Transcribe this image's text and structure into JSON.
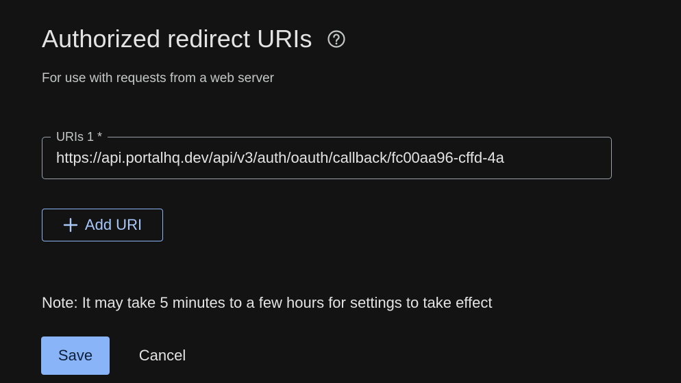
{
  "section": {
    "title": "Authorized redirect URIs",
    "help_icon": "help-circle-icon",
    "subtitle": "For use with requests from a web server"
  },
  "uri_field": {
    "label": "URIs 1 *",
    "value": "https://api.portalhq.dev/api/v3/auth/oauth/callback/fc00aa96-cffd-4a"
  },
  "add_uri": {
    "icon": "plus-icon",
    "label": "Add URI"
  },
  "note": "Note: It may take 5 minutes to a few hours for settings to take effect",
  "actions": {
    "save_label": "Save",
    "cancel_label": "Cancel"
  },
  "colors": {
    "background": "#131313",
    "accent": "#8ab4f8",
    "text": "#e3e3e3"
  }
}
